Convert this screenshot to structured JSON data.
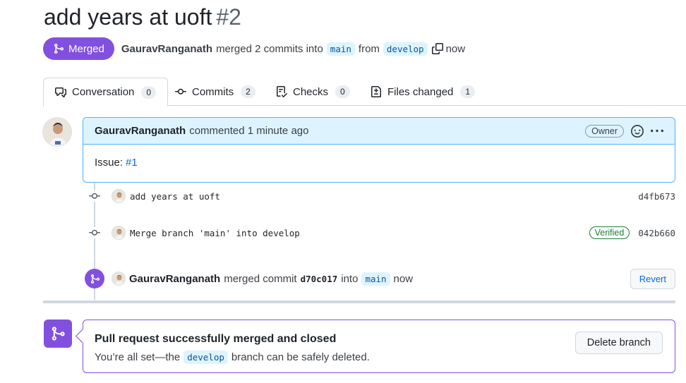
{
  "pr": {
    "title": "add years at uoft",
    "number": "#2",
    "state": "Merged",
    "author": "GauravRanganath",
    "merged_text": "merged 2 commits into",
    "base_branch": "main",
    "from_text": "from",
    "head_branch": "develop",
    "time": "now"
  },
  "tabs": [
    {
      "label": "Conversation",
      "count": "0",
      "icon": "comment-discussion-icon"
    },
    {
      "label": "Commits",
      "count": "2",
      "icon": "git-commit-icon"
    },
    {
      "label": "Checks",
      "count": "0",
      "icon": "checklist-icon"
    },
    {
      "label": "Files changed",
      "count": "1",
      "icon": "file-diff-icon"
    }
  ],
  "comment": {
    "author": "GauravRanganath",
    "action": "commented 1 minute ago",
    "badge": "Owner",
    "body_prefix": "Issue:",
    "body_link": "#1"
  },
  "commits": [
    {
      "message": "add years at uoft",
      "sha": "d4fb673",
      "verified": ""
    },
    {
      "message": "Merge branch 'main' into develop",
      "sha": "042b660",
      "verified": "Verified"
    }
  ],
  "merge_event": {
    "author": "GauravRanganath",
    "text": "merged commit",
    "sha": "d70c017",
    "into": "into",
    "branch": "main",
    "time": "now",
    "revert_label": "Revert"
  },
  "merged_box": {
    "title": "Pull request successfully merged and closed",
    "sub_before": "You’re all set—the",
    "branch": "develop",
    "sub_after": "branch can be safely deleted.",
    "delete_label": "Delete branch"
  },
  "colors": {
    "accent_purple": "#8250df",
    "link_blue": "#0969da",
    "comment_border": "#54aeff",
    "verified_green": "#1a7f37"
  }
}
